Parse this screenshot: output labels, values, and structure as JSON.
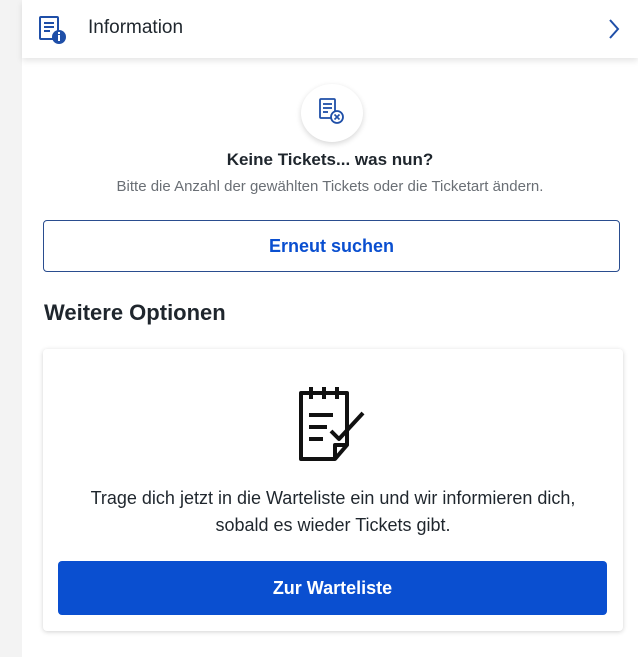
{
  "info_bar": {
    "label": "Information",
    "icon": "ticket-info-icon",
    "chevron": "chevron-right-icon"
  },
  "empty_state": {
    "icon": "ticket-cancel-icon",
    "title": "Keine Tickets... was nun?",
    "subtitle": "Bitte die Anzahl der gewählten Tickets oder die Ticketart ändern."
  },
  "retry_button": "Erneut suchen",
  "more_options": {
    "title": "Weitere Optionen",
    "card": {
      "icon": "waitlist-notepad-icon",
      "text": "Trage dich jetzt in die Warteliste ein und wir informieren dich, sobald es wieder Tickets gibt.",
      "button": "Zur Warteliste"
    }
  },
  "colors": {
    "accent": "#0a4fd0",
    "text": "#1f262d",
    "muted": "#6a6f75"
  }
}
